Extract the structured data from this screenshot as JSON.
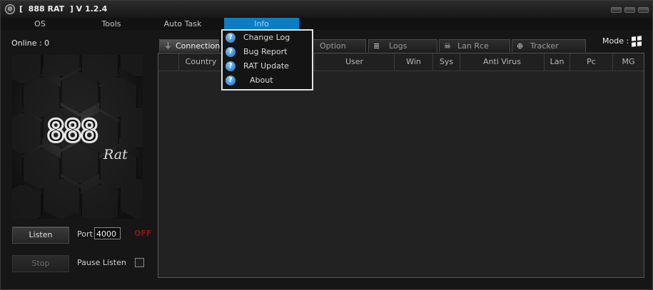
{
  "window": {
    "icon": "app-logo-icon",
    "title": "[  888 RAT  ] V 1.2.4"
  },
  "menu": {
    "items": [
      {
        "label": "OS"
      },
      {
        "label": "Tools"
      },
      {
        "label": "Auto Task"
      },
      {
        "label": "Info",
        "active": true
      }
    ],
    "info_dropdown": [
      {
        "label": "Change Log",
        "icon": "help-icon"
      },
      {
        "label": "Bug Report",
        "icon": "help-icon"
      },
      {
        "label": "RAT Update",
        "icon": "help-icon"
      },
      {
        "label": "About",
        "icon": "help-icon"
      }
    ]
  },
  "left_panel": {
    "online_label": "Online : 0",
    "logo_number": "888",
    "logo_word": "Rat",
    "listen_button": "Listen",
    "stop_button": "Stop",
    "port_label": "Port",
    "port_value": "4000",
    "status": "OFF",
    "pause_label": "Pause Listen",
    "pause_checked": false
  },
  "tabs": [
    {
      "label": "Connection",
      "icon": "plug-icon",
      "active": true
    },
    {
      "label": "Option",
      "icon": ""
    },
    {
      "label": "Logs",
      "icon": "database-icon"
    },
    {
      "label": "Lan Rce",
      "icon": "skull-icon"
    },
    {
      "label": "Tracker",
      "icon": "globe-icon"
    }
  ],
  "mode": {
    "label": "Mode :",
    "icon": "windows-icon"
  },
  "table": {
    "columns": [
      "Country",
      "User",
      "Win",
      "Sys",
      "Anti Virus",
      "Lan",
      "Pc",
      "MG"
    ],
    "rows": []
  },
  "colors": {
    "accent": "#0a7dc4",
    "status_off": "#8a1515",
    "background": "#161616"
  }
}
